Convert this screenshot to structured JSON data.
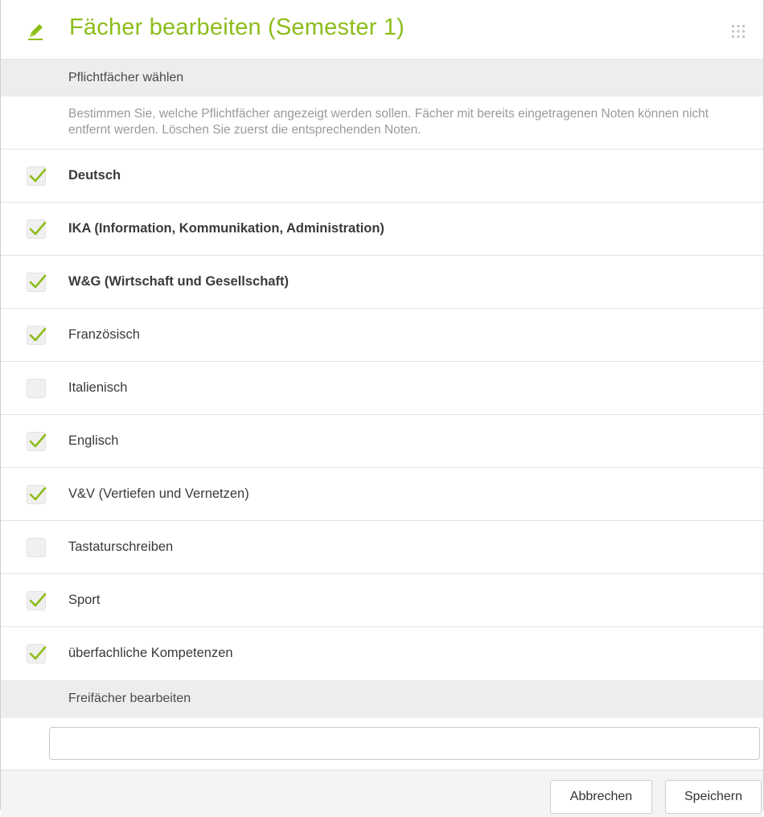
{
  "dialog": {
    "title": "Fächer bearbeiten (Semester 1)",
    "accent_color": "#8cbd1a",
    "header_icon": "pencil-icon",
    "menu_icon": "grip-icon"
  },
  "pflichtfaecher": {
    "section_label": "Pflichtfächer wählen",
    "description": "Bestimmen Sie, welche Pflichtfächer angezeigt werden sollen. Fächer mit bereits eingetragenen Noten können nicht entfernt werden. Löschen Sie zuerst die entsprechenden Noten.",
    "items": [
      {
        "label": "Deutsch",
        "checked": true,
        "bold": true
      },
      {
        "label": "IKA (Information, Kommunikation, Administration)",
        "checked": true,
        "bold": true
      },
      {
        "label": "W&G (Wirtschaft und Gesellschaft)",
        "checked": true,
        "bold": true
      },
      {
        "label": "Französisch",
        "checked": true,
        "bold": false
      },
      {
        "label": "Italienisch",
        "checked": false,
        "bold": false
      },
      {
        "label": "Englisch",
        "checked": true,
        "bold": false
      },
      {
        "label": "V&V (Vertiefen und Vernetzen)",
        "checked": true,
        "bold": false
      },
      {
        "label": "Tastaturschreiben",
        "checked": false,
        "bold": false
      },
      {
        "label": "Sport",
        "checked": true,
        "bold": false
      },
      {
        "label": "überfachliche Kompetenzen",
        "checked": true,
        "bold": false
      }
    ]
  },
  "freifaecher": {
    "section_label": "Freifächer bearbeiten",
    "input_value": "",
    "input_placeholder": ""
  },
  "footer": {
    "cancel_label": "Abbrechen",
    "save_label": "Speichern"
  }
}
